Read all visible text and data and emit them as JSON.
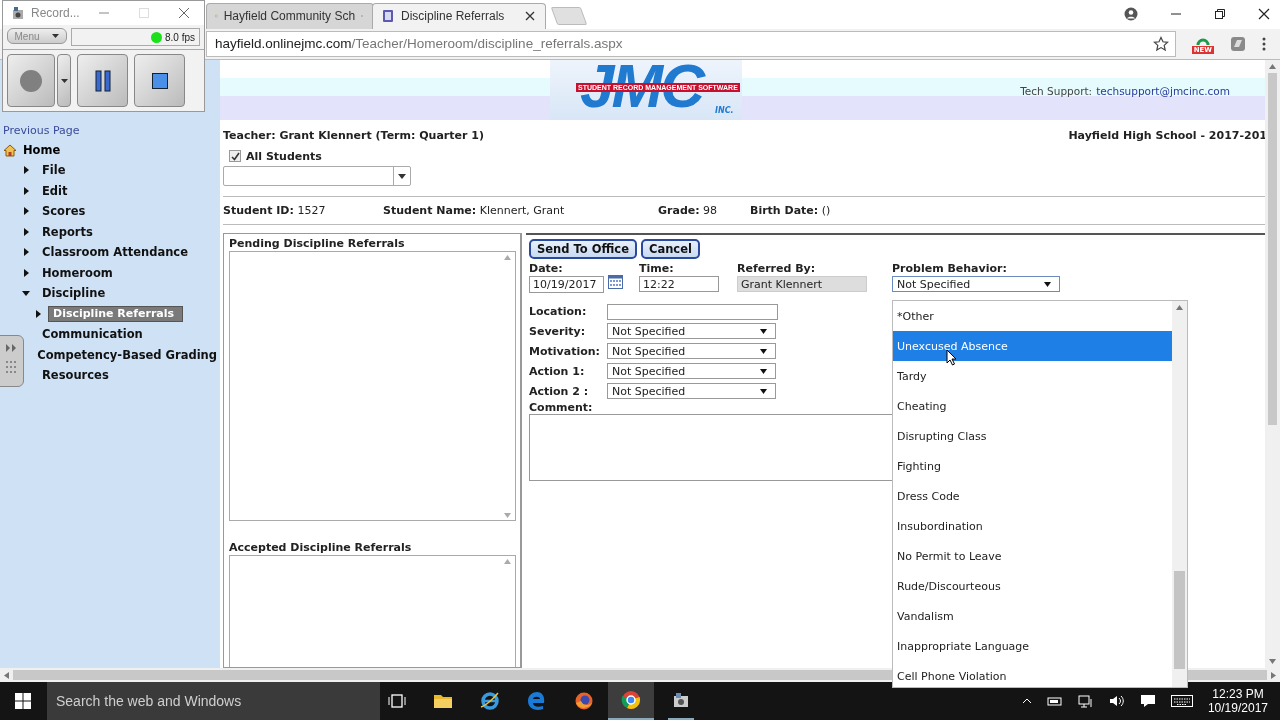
{
  "browser": {
    "tabs": [
      {
        "title": "Hayfield Community Sch",
        "selected": false
      },
      {
        "title": "Discipline Referrals",
        "selected": true
      }
    ],
    "url": {
      "domain": "hayfield.onlinejmc.com",
      "path": "/Teacher/Homeroom/discipline_referrals.aspx"
    },
    "extension_badge": "NEW"
  },
  "recorder": {
    "title": "Record...",
    "menu": "Menu",
    "fps": "8.0 fps"
  },
  "header": {
    "logo": {
      "letters": "JMC",
      "banner": "STUDENT RECORD MANAGEMENT SOFTWARE",
      "suffix": "INC."
    },
    "support_label": "Tech Support:",
    "support_email": "techsupport@jmcinc.com"
  },
  "sidebar": {
    "previous_page": "Previous Page",
    "home": "Home",
    "items": [
      {
        "label": "File",
        "expanded": false,
        "selected": false
      },
      {
        "label": "Edit",
        "expanded": false,
        "selected": false
      },
      {
        "label": "Scores",
        "expanded": false,
        "selected": false
      },
      {
        "label": "Reports",
        "expanded": false,
        "selected": false
      },
      {
        "label": "Classroom Attendance",
        "expanded": false,
        "selected": false
      },
      {
        "label": "Homeroom",
        "expanded": false,
        "selected": false
      },
      {
        "label": "Discipline",
        "expanded": true,
        "selected": false,
        "children": [
          {
            "label": "Discipline Referrals",
            "expanded": false,
            "selected": true
          }
        ]
      },
      {
        "label": "Communication",
        "selected": false
      },
      {
        "label": "Competency-Based Grading",
        "selected": false
      },
      {
        "label": "Resources",
        "selected": false
      }
    ]
  },
  "teacher": "Teacher: Grant Klennert (Term: Quarter 1)",
  "school": "Hayfield High School - 2017-201",
  "all_students": {
    "label": "All Students",
    "checked": true
  },
  "student": [
    {
      "label": "Student ID:",
      "value": "1527"
    },
    {
      "label": "Student Name:",
      "value": "Klennert, Grant"
    },
    {
      "label": "Grade:",
      "value": "98"
    },
    {
      "label": "Birth Date:",
      "value": "()"
    }
  ],
  "pending": {
    "title": "Pending Discipline Referrals"
  },
  "accepted": {
    "title": "Accepted Discipline Referrals"
  },
  "form": {
    "buttons": [
      "Send To Office",
      "Cancel"
    ],
    "date": {
      "label": "Date:",
      "value": "10/19/2017"
    },
    "time": {
      "label": "Time:",
      "value": "12:22"
    },
    "referred_by": {
      "label": "Referred By:",
      "value": "Grant Klennert"
    },
    "problem_behavior": {
      "label": "Problem Behavior:",
      "value": "Not Specified",
      "expanded": true,
      "options": [
        {
          "label": "*Other",
          "selected": false
        },
        {
          "label": "Unexcused Absence",
          "selected": true
        },
        {
          "label": "Tardy",
          "selected": false
        },
        {
          "label": "Cheating",
          "selected": false
        },
        {
          "label": "Disrupting Class",
          "selected": false
        },
        {
          "label": "Fighting",
          "selected": false
        },
        {
          "label": "Dress Code",
          "selected": false
        },
        {
          "label": "Insubordination",
          "selected": false
        },
        {
          "label": "No Permit to Leave",
          "selected": false
        },
        {
          "label": "Rude/Discourteous",
          "selected": false
        },
        {
          "label": "Vandalism",
          "selected": false
        },
        {
          "label": "Inappropriate Language",
          "selected": false
        },
        {
          "label": "Cell Phone Violation",
          "selected": false
        }
      ]
    },
    "location": {
      "label": "Location:"
    },
    "selects": [
      {
        "label": "Severity:",
        "value": "Not Specified"
      },
      {
        "label": "Motivation:",
        "value": "Not Specified"
      },
      {
        "label": "Action 1:",
        "value": "Not Specified"
      },
      {
        "label": "Action 2 :",
        "value": "Not Specified"
      }
    ],
    "comment": {
      "label": "Comment:"
    }
  },
  "taskbar": {
    "search_placeholder": "Search the web and Windows",
    "time": "12:23 PM",
    "date": "10/19/2017"
  }
}
